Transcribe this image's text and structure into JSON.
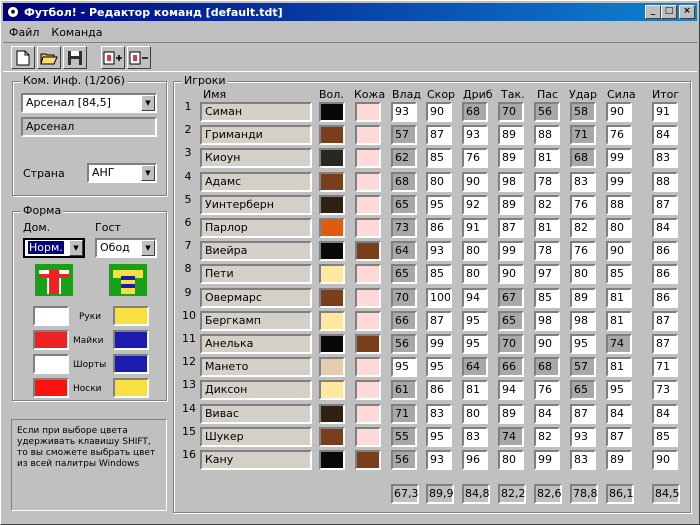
{
  "window": {
    "title": "Футбол! - Редактор команд [default.tdt]",
    "min": "_",
    "max": "□",
    "close": "×"
  },
  "menu": [
    "Файл",
    "Команда"
  ],
  "team_info": {
    "legend": "Ком. Инф. (1/206)",
    "team_select": "Арсенал [84,5]",
    "team_name": "Арсенал",
    "country_label": "Страна",
    "country_value": "АНГ"
  },
  "form": {
    "legend": "Форма",
    "home_label": "Дом.",
    "away_label": "Гост",
    "home_select": "Норм.",
    "away_select": "Обод",
    "parts": [
      "Руки",
      "Майки",
      "Шорты",
      "Носки"
    ],
    "home_colors": [
      "#ffffff",
      "#ee2222",
      "#ffffff",
      "#ff1111"
    ],
    "away_colors": [
      "#f8e040",
      "#1b1bb0",
      "#1b1bb0",
      "#f8e040"
    ]
  },
  "hint": "Если при выборе цвета удерживать клавишу SHIFT, то вы сможете выбрать цвет из всей палитры Windows",
  "players_legend": "Игроки",
  "columns": {
    "name": "Имя",
    "hair": "Вол.",
    "skin": "Кожа",
    "stats": [
      "Влад",
      "Скор",
      "Дриб",
      "Так.",
      "Пас",
      "Удар",
      "Сила"
    ],
    "total": "Итог"
  },
  "players": [
    {
      "n": "1",
      "name": "Симан",
      "hair": "#080808",
      "skin": "#ffd8d8",
      "stats": [
        "93",
        "90",
        "68",
        "70",
        "56",
        "58",
        "90"
      ],
      "total": "91"
    },
    {
      "n": "2",
      "name": "Гриманди",
      "hair": "#7a3e1a",
      "skin": "#ffd8d8",
      "stats": [
        "57",
        "87",
        "93",
        "89",
        "88",
        "71",
        "76"
      ],
      "total": "84"
    },
    {
      "n": "3",
      "name": "Киоун",
      "hair": "#282820",
      "skin": "#ffd8d8",
      "stats": [
        "62",
        "85",
        "76",
        "89",
        "81",
        "68",
        "99"
      ],
      "total": "83"
    },
    {
      "n": "4",
      "name": "Адамс",
      "hair": "#7a3e1a",
      "skin": "#ffd8d8",
      "stats": [
        "68",
        "80",
        "90",
        "98",
        "78",
        "83",
        "99"
      ],
      "total": "88"
    },
    {
      "n": "5",
      "name": "Уинтерберн",
      "hair": "#302010",
      "skin": "#ffd8d8",
      "stats": [
        "65",
        "95",
        "92",
        "89",
        "82",
        "76",
        "88"
      ],
      "total": "87"
    },
    {
      "n": "6",
      "name": "Парлор",
      "hair": "#e05a10",
      "skin": "#ffd8d8",
      "stats": [
        "73",
        "86",
        "91",
        "87",
        "81",
        "82",
        "80"
      ],
      "total": "84"
    },
    {
      "n": "7",
      "name": "Виейра",
      "hair": "#080808",
      "skin": "#7a3e1a",
      "stats": [
        "64",
        "93",
        "80",
        "99",
        "78",
        "76",
        "90"
      ],
      "total": "86"
    },
    {
      "n": "8",
      "name": "Пети",
      "hair": "#ffe8a0",
      "skin": "#ffd8d8",
      "stats": [
        "65",
        "85",
        "80",
        "90",
        "97",
        "80",
        "85"
      ],
      "total": "86"
    },
    {
      "n": "9",
      "name": "Овермарс",
      "hair": "#7a3e1a",
      "skin": "#ffd8d8",
      "stats": [
        "70",
        "100",
        "94",
        "67",
        "85",
        "89",
        "81"
      ],
      "total": "86"
    },
    {
      "n": "10",
      "name": "Бергкамп",
      "hair": "#ffe8a0",
      "skin": "#ffd8d8",
      "stats": [
        "66",
        "87",
        "95",
        "65",
        "98",
        "98",
        "81"
      ],
      "total": "87"
    },
    {
      "n": "11",
      "name": "Анелька",
      "hair": "#080808",
      "skin": "#7a3e1a",
      "stats": [
        "56",
        "99",
        "95",
        "70",
        "90",
        "95",
        "74"
      ],
      "total": "87"
    },
    {
      "n": "12",
      "name": "Мането",
      "hair": "#e8ccb0",
      "skin": "#ffd8d8",
      "stats": [
        "95",
        "95",
        "64",
        "66",
        "68",
        "57",
        "81"
      ],
      "total": "71"
    },
    {
      "n": "13",
      "name": "Диксон",
      "hair": "#ffe8a0",
      "skin": "#ffd8d8",
      "stats": [
        "61",
        "86",
        "81",
        "94",
        "76",
        "65",
        "95"
      ],
      "total": "73"
    },
    {
      "n": "14",
      "name": "Вивас",
      "hair": "#302010",
      "skin": "#ffd8d8",
      "stats": [
        "71",
        "83",
        "80",
        "89",
        "84",
        "87",
        "84"
      ],
      "total": "84"
    },
    {
      "n": "15",
      "name": "Шукер",
      "hair": "#7a3e1a",
      "skin": "#ffd8d8",
      "stats": [
        "55",
        "95",
        "83",
        "74",
        "82",
        "93",
        "87"
      ],
      "total": "85"
    },
    {
      "n": "16",
      "name": "Кану",
      "hair": "#080808",
      "skin": "#7a3e1a",
      "stats": [
        "56",
        "93",
        "96",
        "80",
        "99",
        "83",
        "89"
      ],
      "total": "90"
    }
  ],
  "averages": {
    "stats": [
      "67,3",
      "89,9",
      "84,8",
      "82,2",
      "82,6",
      "78,8",
      "86,1"
    ],
    "total": "84,5"
  }
}
